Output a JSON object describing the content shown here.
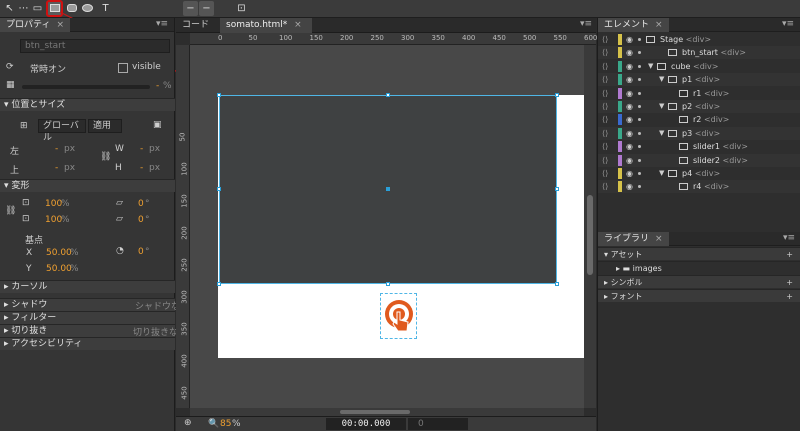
{
  "toolbar": {
    "tools": [
      "select-tool",
      "transform-tool",
      "clip-tool",
      "rectangle-tool",
      "rounded-rectangle-tool",
      "ellipse-tool",
      "text-tool",
      "minus-tool-1",
      "minus-tool-2",
      "crop-tool"
    ],
    "text_tool_glyph": "T"
  },
  "properties": {
    "tab_label": "プロパティ",
    "element_id": "btn_start",
    "overflow": "常時オン",
    "visibility": "visible",
    "opacity_unit": "%",
    "opacity_value": "-",
    "section_position": "位置とサイズ",
    "coord_mode": "グローバル",
    "apply_label": "適用",
    "left_label": "左",
    "top_label": "上",
    "width_label": "W",
    "height_label": "H",
    "left_value": "-",
    "top_value": "-",
    "width_value": "-",
    "height_value": "-",
    "px": "px",
    "section_transform": "変形",
    "scale_x": "100",
    "scale_y": "100",
    "pct": "%",
    "skew_x": "0",
    "skew_y": "0",
    "deg": "°",
    "origin_label": "基点",
    "origin_x_label": "X",
    "origin_y_label": "Y",
    "origin_x": "50.00",
    "origin_y": "50.00",
    "rotation": "0",
    "section_cursor": "カーソル",
    "section_shadow": "シャドウ",
    "shadow_value": "シャドウな",
    "section_filter": "フィルター",
    "section_clip": "切り抜き",
    "clip_value": "切り抜きな",
    "section_accessibility": "アクセシビリティ"
  },
  "stage": {
    "tab_code": "コード",
    "tab_doc": "somato.html*",
    "ruler_h": [
      "0",
      "50",
      "100",
      "150",
      "200",
      "250",
      "300",
      "350",
      "400",
      "450",
      "500",
      "550",
      "600"
    ],
    "ruler_v": [
      "50",
      "100",
      "150",
      "200",
      "250",
      "300",
      "350",
      "400",
      "450"
    ],
    "zoom_value": "85",
    "zoom_unit": "%",
    "timecode": "00:00.000",
    "time_field": "0"
  },
  "elements": {
    "tab_label": "エレメント",
    "rows": [
      {
        "name": "Stage",
        "tag": "<div>",
        "color": "#d6c24a",
        "indent": 0,
        "tri": "",
        "box": true
      },
      {
        "name": "btn_start",
        "tag": "<div>",
        "color": "#d6c24a",
        "indent": 2,
        "tri": "",
        "box": true
      },
      {
        "name": "cube",
        "tag": "<div>",
        "color": "#3aa88a",
        "indent": 1,
        "tri": "▼",
        "box": true
      },
      {
        "name": "p1",
        "tag": "<div>",
        "color": "#3aa88a",
        "indent": 2,
        "tri": "▼",
        "box": true
      },
      {
        "name": "r1",
        "tag": "<div>",
        "color": "#b07ad0",
        "indent": 3,
        "tri": "",
        "box": true
      },
      {
        "name": "p2",
        "tag": "<div>",
        "color": "#3aa88a",
        "indent": 2,
        "tri": "▼",
        "box": true
      },
      {
        "name": "r2",
        "tag": "<div>",
        "color": "#3a6ad0",
        "indent": 3,
        "tri": "",
        "box": true
      },
      {
        "name": "p3",
        "tag": "<div>",
        "color": "#3aa88a",
        "indent": 2,
        "tri": "▼",
        "box": true
      },
      {
        "name": "slider1",
        "tag": "<div>",
        "color": "#b07ad0",
        "indent": 3,
        "tri": "",
        "box": true
      },
      {
        "name": "slider2",
        "tag": "<div>",
        "color": "#b07ad0",
        "indent": 3,
        "tri": "",
        "box": true
      },
      {
        "name": "p4",
        "tag": "<div>",
        "color": "#d6c24a",
        "indent": 2,
        "tri": "▼",
        "box": true
      },
      {
        "name": "r4",
        "tag": "<div>",
        "color": "#d6c24a",
        "indent": 3,
        "tri": "",
        "box": true
      }
    ]
  },
  "library": {
    "tab_label": "ライブラリ",
    "assets": "アセット",
    "images": "images",
    "symbols": "シンボル",
    "fonts": "フォント"
  },
  "colors": {
    "selection": "#4fb6e6",
    "highlight_red": "#d01010",
    "accent_orange": "#f0a030",
    "logo_orange": "#e05a1e"
  }
}
